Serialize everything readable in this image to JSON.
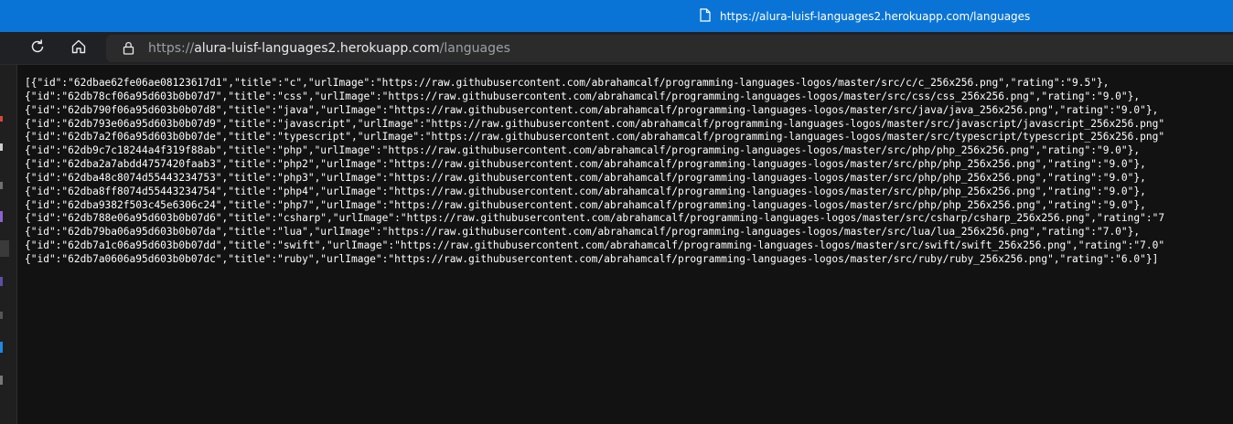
{
  "tooltip": {
    "url": "https://alura-luisf-languages2.herokuapp.com/languages"
  },
  "toolbar": {
    "reload_icon": "reload-icon",
    "home_icon": "home-icon",
    "lock_icon": "lock-icon",
    "url_scheme": "https://",
    "url_host": "alura-luisf-languages2.herokuapp.com",
    "url_path": "/languages"
  },
  "colors": {
    "tooltip_bg": "#0a74d6",
    "toolbar_bg": "#202124",
    "page_bg": "#121212",
    "text": "#ffffff"
  },
  "content": {
    "lines": [
      "[{\"id\":\"62dbae62fe06ae08123617d1\",\"title\":\"c\",\"urlImage\":\"https://raw.githubusercontent.com/abrahamcalf/programming-languages-logos/master/src/c/c_256x256.png\",\"rating\":\"9.5\"},",
      "{\"id\":\"62db78cf06a95d603b0b07d7\",\"title\":\"css\",\"urlImage\":\"https://raw.githubusercontent.com/abrahamcalf/programming-languages-logos/master/src/css/css_256x256.png\",\"rating\":\"9.0\"},",
      "{\"id\":\"62db790f06a95d603b0b07d8\",\"title\":\"java\",\"urlImage\":\"https://raw.githubusercontent.com/abrahamcalf/programming-languages-logos/master/src/java/java_256x256.png\",\"rating\":\"9.0\"},",
      "{\"id\":\"62db793e06a95d603b0b07d9\",\"title\":\"javascript\",\"urlImage\":\"https://raw.githubusercontent.com/abrahamcalf/programming-languages-logos/master/src/javascript/javascript_256x256.png\"",
      "{\"id\":\"62db7a2f06a95d603b0b07de\",\"title\":\"typescript\",\"urlImage\":\"https://raw.githubusercontent.com/abrahamcalf/programming-languages-logos/master/src/typescript/typescript_256x256.png\"",
      "{\"id\":\"62db9c7c18244a4f319f88ab\",\"title\":\"php\",\"urlImage\":\"https://raw.githubusercontent.com/abrahamcalf/programming-languages-logos/master/src/php/php_256x256.png\",\"rating\":\"9.0\"},",
      "{\"id\":\"62dba2a7abdd4757420faab3\",\"title\":\"php2\",\"urlImage\":\"https://raw.githubusercontent.com/abrahamcalf/programming-languages-logos/master/src/php/php_256x256.png\",\"rating\":\"9.0\"},",
      "{\"id\":\"62dba48c8074d55443234753\",\"title\":\"php3\",\"urlImage\":\"https://raw.githubusercontent.com/abrahamcalf/programming-languages-logos/master/src/php/php_256x256.png\",\"rating\":\"9.0\"},",
      "{\"id\":\"62dba8ff8074d55443234754\",\"title\":\"php4\",\"urlImage\":\"https://raw.githubusercontent.com/abrahamcalf/programming-languages-logos/master/src/php/php_256x256.png\",\"rating\":\"9.0\"},",
      "{\"id\":\"62dba9382f503c45e6306c24\",\"title\":\"php7\",\"urlImage\":\"https://raw.githubusercontent.com/abrahamcalf/programming-languages-logos/master/src/php/php_256x256.png\",\"rating\":\"9.0\"},",
      "{\"id\":\"62db788e06a95d603b0b07d6\",\"title\":\"csharp\",\"urlImage\":\"https://raw.githubusercontent.com/abrahamcalf/programming-languages-logos/master/src/csharp/csharp_256x256.png\",\"rating\":\"7",
      "{\"id\":\"62db79ba06a95d603b0b07da\",\"title\":\"lua\",\"urlImage\":\"https://raw.githubusercontent.com/abrahamcalf/programming-languages-logos/master/src/lua/lua_256x256.png\",\"rating\":\"7.0\"},",
      "{\"id\":\"62db7a1c06a95d603b0b07dd\",\"title\":\"swift\",\"urlImage\":\"https://raw.githubusercontent.com/abrahamcalf/programming-languages-logos/master/src/swift/swift_256x256.png\",\"rating\":\"7.0\"",
      "{\"id\":\"62db7a0606a95d603b0b07dc\",\"title\":\"ruby\",\"urlImage\":\"https://raw.githubusercontent.com/abrahamcalf/programming-languages-logos/master/src/ruby/ruby_256x256.png\",\"rating\":\"6.0\"}]"
    ]
  }
}
